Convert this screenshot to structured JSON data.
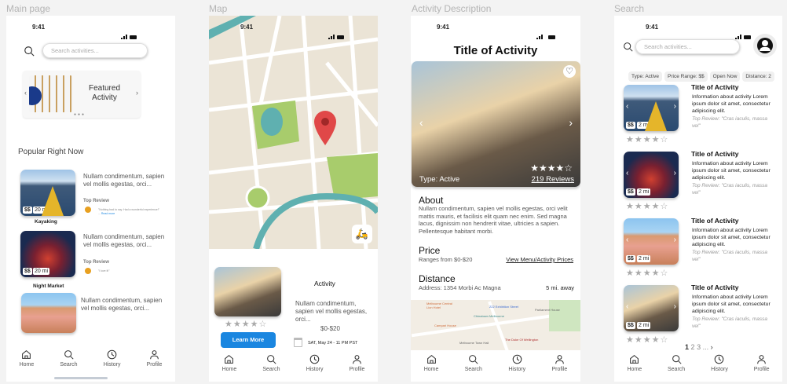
{
  "frames": {
    "main": "Main page",
    "map": "Map",
    "activity": "Activity Description",
    "search": "Search"
  },
  "status_time": "9:41",
  "nav": [
    "Home",
    "Search",
    "History",
    "Profile"
  ],
  "main": {
    "search_placeholder": "Search activities...",
    "featured": "Featured Activity",
    "popular_heading": "Popular Right Now",
    "items": [
      {
        "name": "Kayaking",
        "desc": "Nullam condimentum, sapien vel mollis egestas, orci...",
        "price": "$$",
        "dist": "20 mi",
        "review_label": "Top Review",
        "review": "\"Nothing bad to say. Had a wonderful experience!\" ...",
        "read_more": "Read more"
      },
      {
        "name": "Night Market",
        "desc": "Nullam condimentum, sapien vel mollis egestas, orci...",
        "price": "$$",
        "dist": "20 mi",
        "review_label": "Top Review",
        "review": "\"I love it!\""
      },
      {
        "desc": "Nullam condimentum, sapien vel mollis egestas, orci..."
      }
    ]
  },
  "map": {
    "title": "Activity",
    "desc": "Nullam condimentum, sapien vel mollis egestas, orci...",
    "price": "$0-$20",
    "date": "SAT, May 24 - 11 PM PST",
    "button": "Learn More",
    "rating": 4
  },
  "activity": {
    "title": "Title of Activity",
    "type": "Type: Active",
    "reviews": "219 Reviews",
    "rating": 4.5,
    "about_h": "About",
    "about": "Nullam condimentum, sapien vel mollis egestas, orci velit mattis mauris, et facilisis elit quam nec enim. Sed magna lacus, dignissim non hendrerit vitae, ultricies a sapien. Pellentesque habitant morbi.",
    "price_h": "Price",
    "price": "Ranges from $0-$20",
    "price_link": "View Menu/Activity Prices",
    "dist_h": "Distance",
    "address": "Address: 1354 Morbi Ac Magna",
    "away": "5 mi. away",
    "map_labels": [
      "Melbourne Central Lion Hotel",
      "222 Exhibition Street",
      "Parliament House",
      "Chinatown Melbourne",
      "Campari House",
      "Melbourne Town Hall",
      "The Duke Of Wellington"
    ]
  },
  "search": {
    "placeholder": "Search activities...",
    "chips": [
      "Type: Active",
      "Price Range: $$",
      "Open Now",
      "Distance: 2"
    ],
    "results": [
      {
        "title": "Title of Activity",
        "info": "Information about activity Lorem ipsum dolor sit amet, consectetur adipiscing elit.",
        "review": "Top Review: \"Cras iaculis, massa vel\"",
        "price": "$$",
        "dist": "2 mi"
      },
      {
        "title": "Title of Activity",
        "info": "Information about activity Lorem ipsum dolor sit amet, consectetur adipiscing elit.",
        "review": "Top Review: \"Cras iaculis, massa vel\"",
        "price": "$$",
        "dist": "2 mi"
      },
      {
        "title": "Title of Activity",
        "info": "Information about activity Lorem ipsum dolor sit amet, consectetur adipiscing elit.",
        "review": "Top Review: \"Cras iaculis, massa vel\"",
        "price": "$$",
        "dist": "2 mi"
      },
      {
        "title": "Title of Activity",
        "info": "Information about activity Lorem ipsum dolor sit amet, consectetur adipiscing elit.",
        "review": "Top Review: \"Cras iaculis, massa vel\"",
        "price": "$$",
        "dist": "2 mi"
      }
    ],
    "pages": [
      "1",
      "2",
      "3",
      "..."
    ]
  },
  "colors": {
    "accent": "#1a86e0",
    "pin": "#e04848",
    "road": "#5fb0b0",
    "park": "#a8cc6c"
  }
}
